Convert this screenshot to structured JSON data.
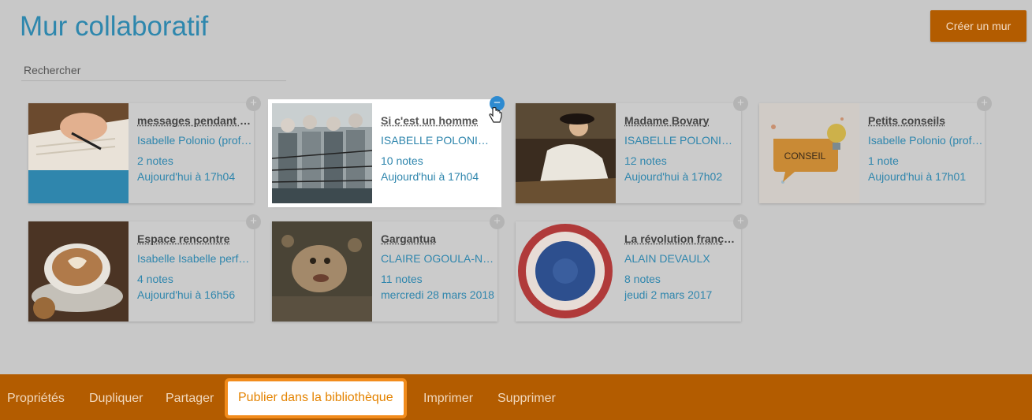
{
  "page": {
    "title": "Mur collaboratif",
    "create_label": "Créer un mur"
  },
  "search": {
    "placeholder": "Rechercher"
  },
  "cards": [
    {
      "title": "messages pendant le confinement",
      "author": "Isabelle Polonio (prof ...",
      "notes": "2 notes",
      "date": "Aujourd'hui à 17h04",
      "image": "writing-hand"
    },
    {
      "title": "Si c'est un homme",
      "author": "ISABELLE POLONIO (...",
      "notes": "10 notes",
      "date": "Aujourd'hui à 17h04",
      "image": "camp-prisoners"
    },
    {
      "title": "Madame Bovary",
      "author": "ISABELLE POLONIO (...",
      "notes": "12 notes",
      "date": "Aujourd'hui à 17h02",
      "image": "woman-painting"
    },
    {
      "title": "Petits conseils",
      "author": "Isabelle Polonio (prof ...",
      "notes": "1 note",
      "date": "Aujourd'hui à 17h01",
      "image": "conseil-bulb",
      "image_text": "CONSEIL"
    },
    {
      "title": "Espace rencontre",
      "author": "Isabelle Isabelle perf t...",
      "notes": "4 notes",
      "date": "Aujourd'hui à 16h56",
      "image": "coffee-cup"
    },
    {
      "title": "Gargantua",
      "author": "CLAIRE OGOULA-NK...",
      "notes": "11 notes",
      "date": "mercredi 28 mars 2018",
      "image": "gargantua-painting"
    },
    {
      "title": "La révolution française",
      "author": "ALAIN DEVAULX",
      "notes": "8 notes",
      "date": "jeudi 2 mars 2017",
      "image": "cockade"
    }
  ],
  "bottom_menu": [
    {
      "label": "Propriétés"
    },
    {
      "label": "Dupliquer"
    },
    {
      "label": "Partager"
    },
    {
      "label": "Publier dans la bibliothèque"
    },
    {
      "label": "Imprimer"
    },
    {
      "label": "Supprimer"
    }
  ],
  "colors": {
    "accent": "#2e87ad",
    "bar": "#b35c00",
    "highlight": "#f28c1c",
    "selected_plus": "#2d8ad0"
  }
}
